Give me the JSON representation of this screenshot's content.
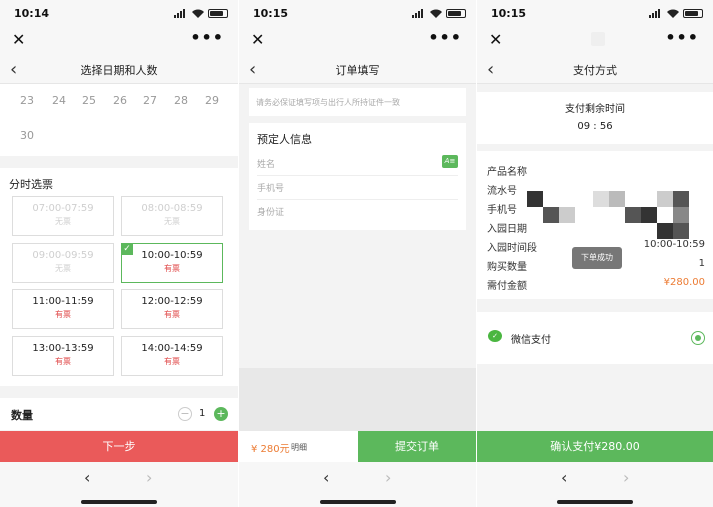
{
  "panel1": {
    "status_time": "10:14",
    "nav_title": "选择日期和人数",
    "dates": [
      "23",
      "24",
      "25",
      "26",
      "27",
      "28",
      "29",
      "30"
    ],
    "slot_section_title": "分时选票",
    "slots": [
      {
        "time": "07:00-07:59",
        "status": "无票"
      },
      {
        "time": "08:00-08:59",
        "status": "无票"
      },
      {
        "time": "09:00-09:59",
        "status": "无票"
      },
      {
        "time": "10:00-10:59",
        "status": "有票"
      },
      {
        "time": "11:00-11:59",
        "status": "有票"
      },
      {
        "time": "12:00-12:59",
        "status": "有票"
      },
      {
        "time": "13:00-13:59",
        "status": "有票"
      },
      {
        "time": "14:00-14:59",
        "status": "有票"
      }
    ],
    "quantity_label": "数量",
    "quantity_value": "1",
    "next_button": "下一步"
  },
  "panel2": {
    "status_time": "10:15",
    "nav_title": "订单填写",
    "notice": "请务必保证填写项与出行人所持证件一致",
    "booker_title": "预定人信息",
    "fields": {
      "name": "姓名",
      "phone": "手机号",
      "id": "身份证"
    },
    "id_icon_text": "A≡",
    "price": "¥ 280元",
    "detail": "明细",
    "submit_button": "提交订单"
  },
  "panel3": {
    "status_time": "10:15",
    "nav_title": "支付方式",
    "remaining_label": "支付剩余时间",
    "countdown": "09 : 56",
    "info_rows": [
      {
        "key": "产品名称",
        "value": ""
      },
      {
        "key": "流水号",
        "value": ""
      },
      {
        "key": "手机号",
        "value": ""
      },
      {
        "key": "入园日期",
        "value": ""
      },
      {
        "key": "入园时间段",
        "value": "10:00-10:59"
      },
      {
        "key": "购买数量",
        "value": "1"
      },
      {
        "key": "需付金额",
        "value": "¥280.00"
      }
    ],
    "toast": "下单成功",
    "pay_method": "微信支付",
    "confirm_button": "确认支付¥280.00"
  },
  "colors": {
    "accent_green": "#5cb85c",
    "next_red": "#ea5a5a",
    "price_orange": "#ec7b33"
  },
  "icons": [
    "close-icon",
    "more-icon",
    "back-chevron-icon",
    "forward-chevron-icon",
    "check-icon",
    "wechat-pay-icon",
    "radio-selected-icon",
    "id-scan-icon"
  ]
}
